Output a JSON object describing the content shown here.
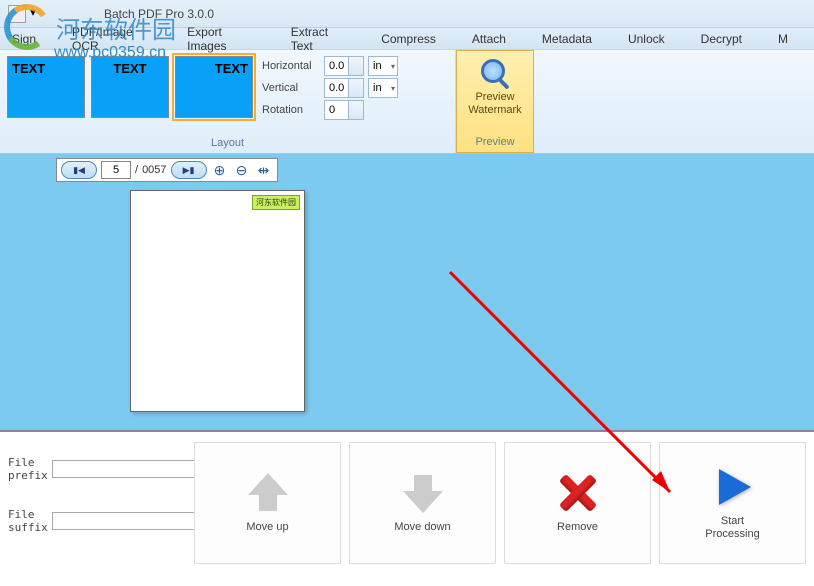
{
  "title": "Batch PDF Pro 3.0.0",
  "menu": [
    "Sign",
    "PDF/Image OCR",
    "Export Images",
    "Extract Text",
    "Compress",
    "Attach",
    "Metadata",
    "Unlock",
    "Decrypt",
    "M"
  ],
  "layout": {
    "thumbs": [
      "TEXT",
      "TEXT",
      "TEXT"
    ],
    "horizontal_label": "Horizontal",
    "horizontal_value": "0.0",
    "horizontal_unit": "in",
    "vertical_label": "Vertical",
    "vertical_value": "0.0",
    "vertical_unit": "in",
    "rotation_label": "Rotation",
    "rotation_value": "0",
    "group_label": "Layout"
  },
  "preview": {
    "button": "Preview\nWatermark",
    "group_label": "Preview"
  },
  "nav": {
    "current": "5",
    "total": "0057"
  },
  "page_badge": "河东软件园",
  "file": {
    "prefix_label": "File prefix",
    "prefix_value": "",
    "suffix_label": "File suffix",
    "suffix_value": ""
  },
  "actions": {
    "move_up": "Move up",
    "move_down": "Move down",
    "remove": "Remove",
    "start": "Start\nProcessing"
  },
  "watermark": {
    "text": "河东软件园",
    "url": "www.pc0359.cn"
  }
}
